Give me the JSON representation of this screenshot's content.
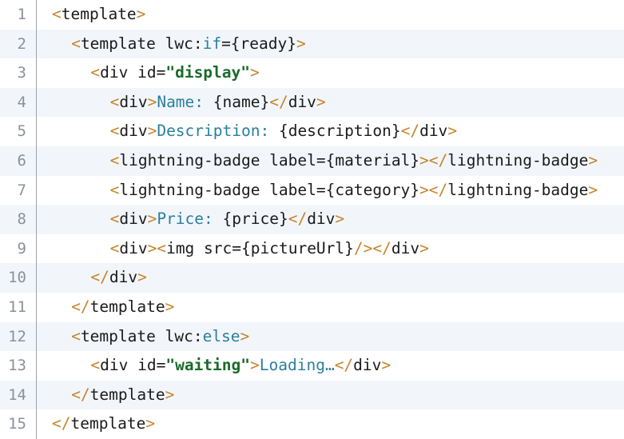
{
  "editor": {
    "name": "lwc-template-code-view",
    "language": "html",
    "total_lines": 15,
    "colors": {
      "background": "#ffffff",
      "alt_row_background": "#f2f6fb",
      "gutter_text": "#8a9199",
      "gutter_divider": "#9aa2aa",
      "punctuation": "#c8842a",
      "tag": "#1b1b1b",
      "directive": "#2a7f9e",
      "string": "#1a6b2a",
      "text_content": "#2a7f9e"
    },
    "lines": [
      {
        "number": "1",
        "indent": 0,
        "tokens": [
          {
            "t": "<",
            "c": "tok-punct"
          },
          {
            "t": "template",
            "c": "tok-tag"
          },
          {
            "t": ">",
            "c": "tok-punct"
          }
        ]
      },
      {
        "number": "2",
        "indent": 1,
        "tokens": [
          {
            "t": "<",
            "c": "tok-punct"
          },
          {
            "t": "template",
            "c": "tok-tag"
          },
          {
            "t": " lwc",
            "c": "tok-attr"
          },
          {
            "t": ":",
            "c": "tok-plain"
          },
          {
            "t": "if",
            "c": "tok-dir"
          },
          {
            "t": "={ready}",
            "c": "tok-plain"
          },
          {
            "t": ">",
            "c": "tok-punct"
          }
        ]
      },
      {
        "number": "3",
        "indent": 2,
        "tokens": [
          {
            "t": "<",
            "c": "tok-punct"
          },
          {
            "t": "div",
            "c": "tok-tag"
          },
          {
            "t": " id=",
            "c": "tok-attr"
          },
          {
            "t": "\"display\"",
            "c": "tok-str"
          },
          {
            "t": ">",
            "c": "tok-punct"
          }
        ]
      },
      {
        "number": "4",
        "indent": 3,
        "tokens": [
          {
            "t": "<",
            "c": "tok-punct"
          },
          {
            "t": "div",
            "c": "tok-tag"
          },
          {
            "t": ">",
            "c": "tok-punct"
          },
          {
            "t": "Name:",
            "c": "tok-text"
          },
          {
            "t": " {name}",
            "c": "tok-plain"
          },
          {
            "t": "</",
            "c": "tok-punct"
          },
          {
            "t": "div",
            "c": "tok-tag"
          },
          {
            "t": ">",
            "c": "tok-punct"
          }
        ]
      },
      {
        "number": "5",
        "indent": 3,
        "tokens": [
          {
            "t": "<",
            "c": "tok-punct"
          },
          {
            "t": "div",
            "c": "tok-tag"
          },
          {
            "t": ">",
            "c": "tok-punct"
          },
          {
            "t": "Description:",
            "c": "tok-text"
          },
          {
            "t": " {description}",
            "c": "tok-plain"
          },
          {
            "t": "</",
            "c": "tok-punct"
          },
          {
            "t": "div",
            "c": "tok-tag"
          },
          {
            "t": ">",
            "c": "tok-punct"
          }
        ]
      },
      {
        "number": "6",
        "indent": 3,
        "tokens": [
          {
            "t": "<",
            "c": "tok-punct"
          },
          {
            "t": "lightning-badge",
            "c": "tok-tag"
          },
          {
            "t": " label={material}",
            "c": "tok-attr"
          },
          {
            "t": ">",
            "c": "tok-punct"
          },
          {
            "t": "</",
            "c": "tok-punct"
          },
          {
            "t": "lightning-badge",
            "c": "tok-tag"
          },
          {
            "t": ">",
            "c": "tok-punct"
          }
        ]
      },
      {
        "number": "7",
        "indent": 3,
        "tokens": [
          {
            "t": "<",
            "c": "tok-punct"
          },
          {
            "t": "lightning-badge",
            "c": "tok-tag"
          },
          {
            "t": " label={category}",
            "c": "tok-attr"
          },
          {
            "t": ">",
            "c": "tok-punct"
          },
          {
            "t": "</",
            "c": "tok-punct"
          },
          {
            "t": "lightning-badge",
            "c": "tok-tag"
          },
          {
            "t": ">",
            "c": "tok-punct"
          }
        ]
      },
      {
        "number": "8",
        "indent": 3,
        "tokens": [
          {
            "t": "<",
            "c": "tok-punct"
          },
          {
            "t": "div",
            "c": "tok-tag"
          },
          {
            "t": ">",
            "c": "tok-punct"
          },
          {
            "t": "Price:",
            "c": "tok-text"
          },
          {
            "t": " {price}",
            "c": "tok-plain"
          },
          {
            "t": "</",
            "c": "tok-punct"
          },
          {
            "t": "div",
            "c": "tok-tag"
          },
          {
            "t": ">",
            "c": "tok-punct"
          }
        ]
      },
      {
        "number": "9",
        "indent": 3,
        "tokens": [
          {
            "t": "<",
            "c": "tok-punct"
          },
          {
            "t": "div",
            "c": "tok-tag"
          },
          {
            "t": ">",
            "c": "tok-punct"
          },
          {
            "t": "<",
            "c": "tok-punct"
          },
          {
            "t": "img",
            "c": "tok-tag"
          },
          {
            "t": " src={pictureUrl}",
            "c": "tok-attr"
          },
          {
            "t": "/>",
            "c": "tok-punct"
          },
          {
            "t": "</",
            "c": "tok-punct"
          },
          {
            "t": "div",
            "c": "tok-tag"
          },
          {
            "t": ">",
            "c": "tok-punct"
          }
        ]
      },
      {
        "number": "10",
        "indent": 2,
        "tokens": [
          {
            "t": "</",
            "c": "tok-punct"
          },
          {
            "t": "div",
            "c": "tok-tag"
          },
          {
            "t": ">",
            "c": "tok-punct"
          }
        ]
      },
      {
        "number": "11",
        "indent": 1,
        "tokens": [
          {
            "t": "</",
            "c": "tok-punct"
          },
          {
            "t": "template",
            "c": "tok-tag"
          },
          {
            "t": ">",
            "c": "tok-punct"
          }
        ]
      },
      {
        "number": "12",
        "indent": 1,
        "tokens": [
          {
            "t": "<",
            "c": "tok-punct"
          },
          {
            "t": "template",
            "c": "tok-tag"
          },
          {
            "t": " lwc",
            "c": "tok-attr"
          },
          {
            "t": ":",
            "c": "tok-plain"
          },
          {
            "t": "else",
            "c": "tok-dir"
          },
          {
            "t": ">",
            "c": "tok-punct"
          }
        ]
      },
      {
        "number": "13",
        "indent": 2,
        "tokens": [
          {
            "t": "<",
            "c": "tok-punct"
          },
          {
            "t": "div",
            "c": "tok-tag"
          },
          {
            "t": " id=",
            "c": "tok-attr"
          },
          {
            "t": "\"waiting\"",
            "c": "tok-str"
          },
          {
            "t": ">",
            "c": "tok-punct"
          },
          {
            "t": "Loading…",
            "c": "tok-text"
          },
          {
            "t": "</",
            "c": "tok-punct"
          },
          {
            "t": "div",
            "c": "tok-tag"
          },
          {
            "t": ">",
            "c": "tok-punct"
          }
        ]
      },
      {
        "number": "14",
        "indent": 1,
        "tokens": [
          {
            "t": "</",
            "c": "tok-punct"
          },
          {
            "t": "template",
            "c": "tok-tag"
          },
          {
            "t": ">",
            "c": "tok-punct"
          }
        ]
      },
      {
        "number": "15",
        "indent": 0,
        "tokens": [
          {
            "t": "</",
            "c": "tok-punct"
          },
          {
            "t": "template",
            "c": "tok-tag"
          },
          {
            "t": ">",
            "c": "tok-punct"
          }
        ]
      }
    ]
  }
}
